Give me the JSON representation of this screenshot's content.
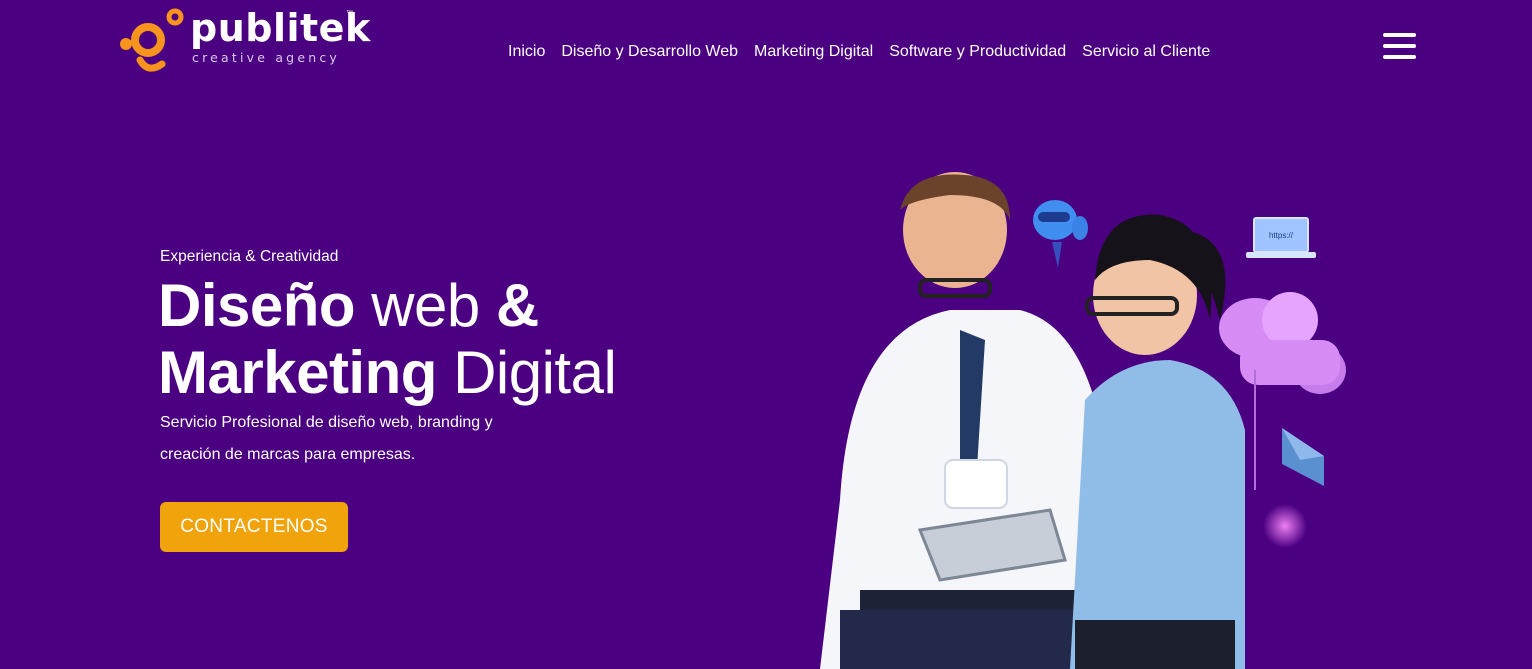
{
  "brand": {
    "name": "publitek",
    "tagline": "creative agency",
    "trademark": "™",
    "colors": {
      "background": "#4b0082",
      "accent": "#f0a30a",
      "logo_mark": "#f7941d",
      "text": "#ffffff"
    }
  },
  "nav": {
    "items": [
      {
        "label": "Inicio"
      },
      {
        "label": "Diseño y Desarrollo Web"
      },
      {
        "label": "Marketing Digital"
      },
      {
        "label": "Software y Productividad"
      },
      {
        "label": "Servicio al Cliente"
      }
    ],
    "menu_icon": "hamburger-icon"
  },
  "hero": {
    "eyebrow": "Experiencia & Creatividad",
    "headline": {
      "line1_bold": "Diseño",
      "line1_light": "web",
      "line1_amp": "&",
      "line2_bold": "Marketing",
      "line2_light": "Digital"
    },
    "description": "Servicio Profesional de diseño web, branding y creación de marcas para empresas.",
    "cta_label": "CONTACTENOS",
    "illustration": {
      "laptop_screen_text": "https://",
      "icons": [
        "robot-icon",
        "laptop-icon",
        "cloud-icon",
        "envelope-icon"
      ]
    }
  }
}
